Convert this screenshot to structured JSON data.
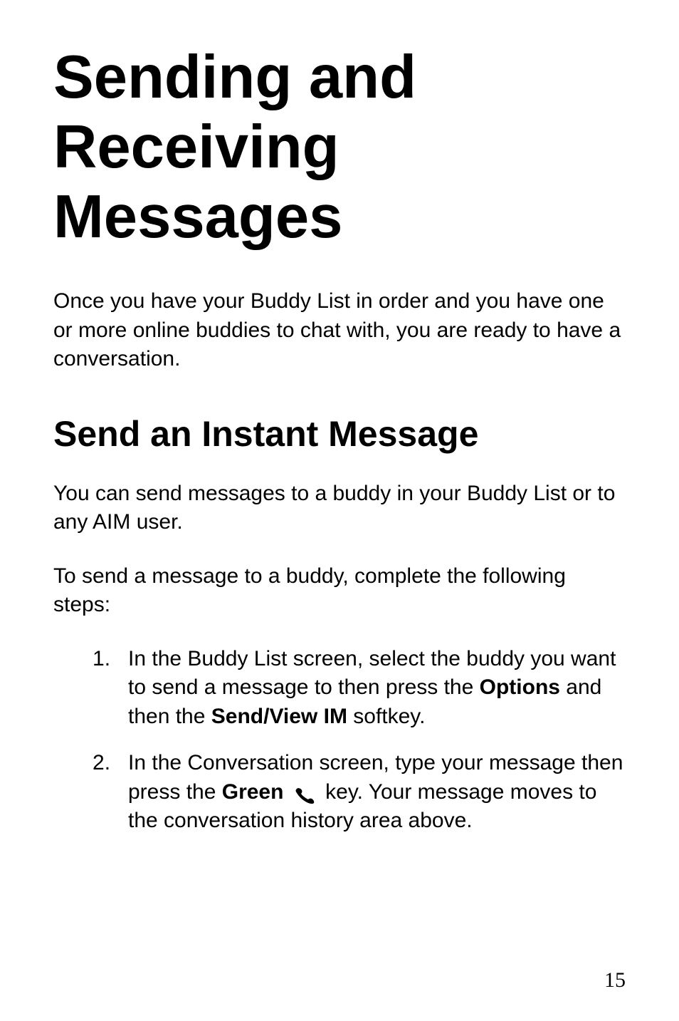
{
  "title": "Sending and Receiving Messages",
  "intro": "Once you have your Buddy List in order and you have one or more online buddies to chat with, you are ready to have a conversation.",
  "sub_heading": "Send an Instant Message",
  "para1": "You can send messages to a buddy in your Buddy List or to any AIM user.",
  "para2": "To send a message to a buddy, complete the following steps:",
  "steps": {
    "s1_a": "In the Buddy List screen, select the buddy you want to send a message to then press the ",
    "s1_b": "Options",
    "s1_c": " and then the ",
    "s1_d": "Send/View IM",
    "s1_e": " softkey.",
    "s2_a": "In the Conversation screen, type your message then press the ",
    "s2_b": "Green",
    "s2_c": " key. Your message moves to the conversation history area above."
  },
  "page_number": "15"
}
